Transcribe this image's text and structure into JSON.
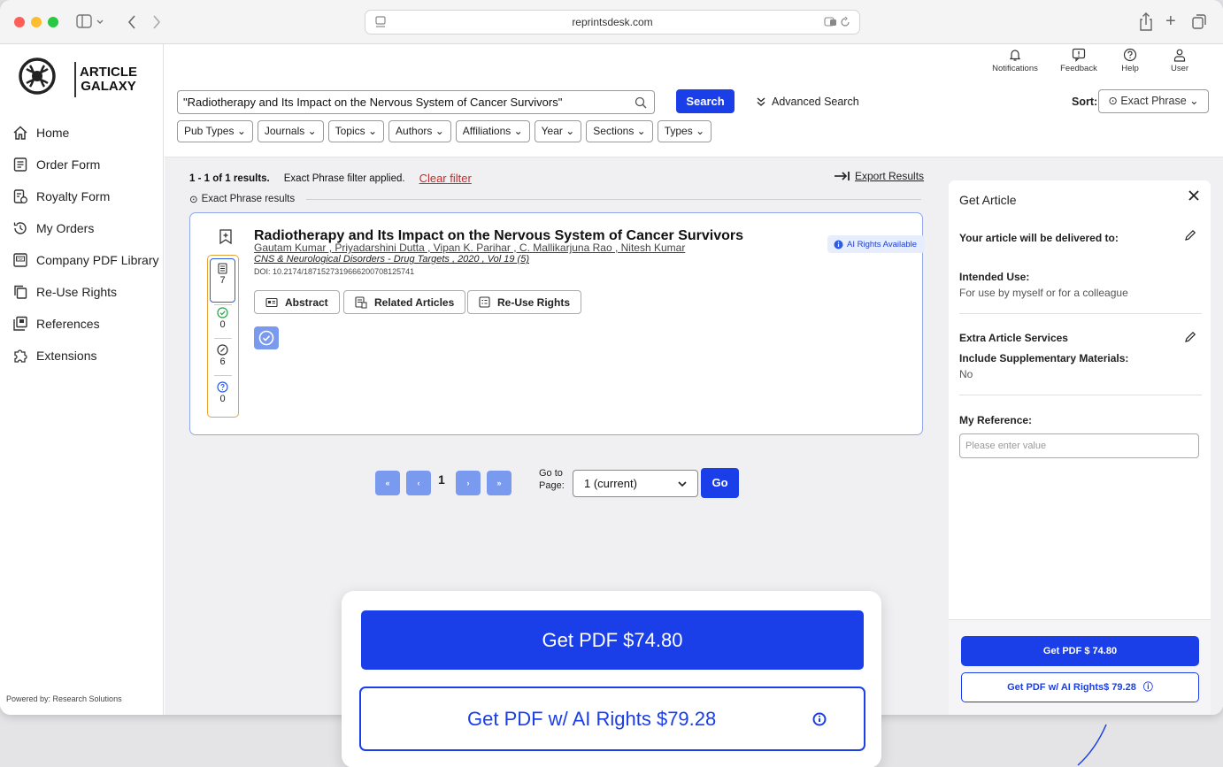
{
  "browser": {
    "url": "reprintsdesk.com"
  },
  "logo": {
    "line1": "ARTICLE",
    "line2": "GALAXY"
  },
  "sidebar": {
    "items": [
      {
        "label": "Home",
        "icon": "home-icon"
      },
      {
        "label": "Order Form",
        "icon": "form-icon"
      },
      {
        "label": "Royalty Form",
        "icon": "royalty-icon"
      },
      {
        "label": "My Orders",
        "icon": "history-icon"
      },
      {
        "label": "Company PDF Library",
        "icon": "pdf-icon"
      },
      {
        "label": "Re-Use Rights",
        "icon": "copy-icon"
      },
      {
        "label": "References",
        "icon": "references-icon"
      },
      {
        "label": "Extensions",
        "icon": "puzzle-icon"
      }
    ],
    "powered_by": "Powered by: Research Solutions"
  },
  "topbar": {
    "notifications": "Notifications",
    "feedback": "Feedback",
    "help": "Help",
    "user": "User"
  },
  "search": {
    "query": "\"Radiotherapy and Its Impact on the Nervous System of Cancer Survivors\"",
    "button": "Search",
    "advanced": "Advanced Search",
    "sort_label": "Sort:",
    "sort_value": "Exact Phrase"
  },
  "filters": [
    "Pub Types",
    "Journals",
    "Topics",
    "Authors",
    "Affiliations",
    "Year",
    "Sections",
    "Types"
  ],
  "results": {
    "count": "1 - 1 of 1 results.",
    "filter_note": "Exact Phrase filter applied.",
    "clear_filter": "Clear filter",
    "export": "Export Results",
    "exact_label": "Exact Phrase results"
  },
  "article": {
    "title": "Radiotherapy and Its Impact on the Nervous System of Cancer Survivors",
    "authors": "Gautam Kumar , Priyadarshini Dutta , Vipan K. Parihar , C. Mallikarjuna Rao , Nitesh Kumar",
    "journal": "CNS & Neurological Disorders - Drug Targets , 2020 , Vol 19 (5)",
    "doi": "DOI: 10.2174/1871527319666200708125741",
    "badge": "AI Rights Available",
    "stats": [
      "7",
      "0",
      "6",
      "0"
    ],
    "buttons": {
      "abstract": "Abstract",
      "related": "Related Articles",
      "reuse": "Re-Use Rights"
    }
  },
  "pagination": {
    "first": "«",
    "prev": "‹",
    "current": "1",
    "next": "›",
    "last": "»",
    "goto_line1": "Go to",
    "goto_line2": "Page:",
    "select": "1 (current)",
    "go": "Go"
  },
  "panel": {
    "title": "Get Article",
    "delivered": "Your article will be delivered to:",
    "intended_label": "Intended Use:",
    "intended_value": "For use by myself or for a colleague",
    "extra_label": "Extra Article Services",
    "supp_label": "Include Supplementary Materials:",
    "supp_value": "No",
    "ref_label": "My Reference:",
    "ref_placeholder": "Please enter value",
    "btn_pdf": "Get PDF $ 74.80",
    "btn_ai": "Get PDF w/ AI Rights$ 79.28"
  },
  "zoom": {
    "btn_pdf": "Get PDF $74.80",
    "btn_ai": "Get PDF w/ AI Rights $79.28"
  },
  "colors": {
    "primary": "#1a3ee8",
    "pager": "#7a9af0",
    "clear": "#c62a2a",
    "stats_border": "#e6a437"
  }
}
